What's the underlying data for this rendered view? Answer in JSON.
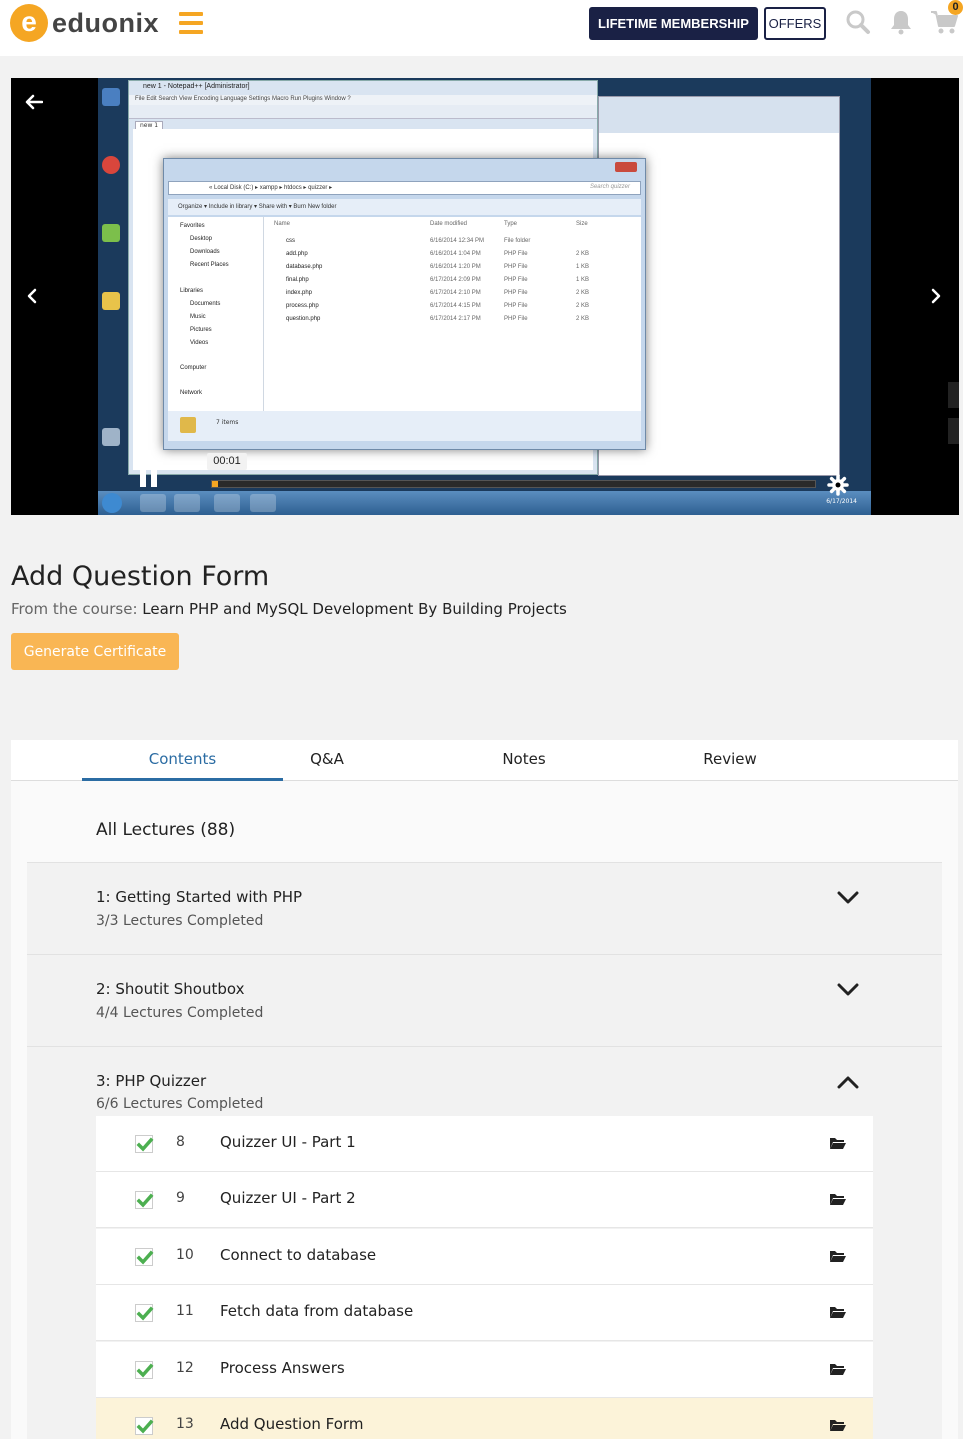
{
  "header": {
    "logo_letter": "e",
    "logo_text": "eduonix",
    "lifetime_label": "LIFETIME MEMBERSHIP",
    "offers_label": "OFFERS",
    "cart_count": "0"
  },
  "video": {
    "time": "00:01",
    "progress_fraction": 0.01,
    "screen": {
      "npp_title": "new 1 - Notepad++ [Administrator]",
      "npp_menu": "File  Edit  Search  View  Encoding  Language  Settings  Macro  Run  Plugins  Window  ?",
      "npp_tab": "new 1",
      "explorer_path": "« Local Disk (C:) ▸ xampp ▸ htdocs ▸ quizzer ▸",
      "explorer_search": "Search quizzer",
      "explorer_cmds": "Organize ▾    Include in library ▾    Share with ▾    Burn    New folder",
      "nav_items": [
        "Favorites",
        "Desktop",
        "Downloads",
        "Recent Places",
        "Libraries",
        "Documents",
        "Music",
        "Pictures",
        "Videos",
        "Computer",
        "Network"
      ],
      "columns": [
        "Name",
        "Date modified",
        "Type",
        "Size"
      ],
      "files": [
        {
          "name": "css",
          "date": "6/16/2014 12:34 PM",
          "type": "File folder",
          "size": ""
        },
        {
          "name": "add.php",
          "date": "6/16/2014 1:04 PM",
          "type": "PHP File",
          "size": "2 KB"
        },
        {
          "name": "database.php",
          "date": "6/16/2014 1:20 PM",
          "type": "PHP File",
          "size": "1 KB"
        },
        {
          "name": "final.php",
          "date": "6/17/2014 2:09 PM",
          "type": "PHP File",
          "size": "1 KB"
        },
        {
          "name": "index.php",
          "date": "6/17/2014 2:10 PM",
          "type": "PHP File",
          "size": "2 KB"
        },
        {
          "name": "process.php",
          "date": "6/17/2014 4:15 PM",
          "type": "PHP File",
          "size": "2 KB"
        },
        {
          "name": "question.php",
          "date": "6/17/2014 2:17 PM",
          "type": "PHP File",
          "size": "2 KB"
        }
      ],
      "item_count": "7 items",
      "taskbar_date": "6/17/2014"
    }
  },
  "lecture": {
    "title": "Add Question Form",
    "course_prefix": "From the course:",
    "course_name": "Learn PHP and MySQL Development By Building Projects",
    "cert_label": "Generate Certificate"
  },
  "tabs": [
    "Contents",
    "Q&A",
    "Notes",
    "Review"
  ],
  "all_lectures": "All Lectures (88)",
  "sections": [
    {
      "title": "1: Getting Started with PHP",
      "sub": "3/3 Lectures Completed",
      "expanded": false
    },
    {
      "title": "2: Shoutit Shoutbox",
      "sub": "4/4 Lectures Completed",
      "expanded": false
    },
    {
      "title": "3: PHP Quizzer",
      "sub": "6/6 Lectures Completed",
      "expanded": true
    }
  ],
  "lectures": [
    {
      "num": "8",
      "title": "Quizzer UI - Part 1",
      "done": true,
      "active": false
    },
    {
      "num": "9",
      "title": "Quizzer UI - Part 2",
      "done": true,
      "active": false
    },
    {
      "num": "10",
      "title": "Connect to database",
      "done": true,
      "active": false
    },
    {
      "num": "11",
      "title": "Fetch data from database",
      "done": true,
      "active": false
    },
    {
      "num": "12",
      "title": "Process Answers",
      "done": true,
      "active": false
    },
    {
      "num": "13",
      "title": "Add Question Form",
      "done": true,
      "active": true
    }
  ],
  "colors": {
    "accent": "#f5a623",
    "navy": "#1a2145",
    "tab_active": "#2b6ca3",
    "check": "#4caf50"
  }
}
